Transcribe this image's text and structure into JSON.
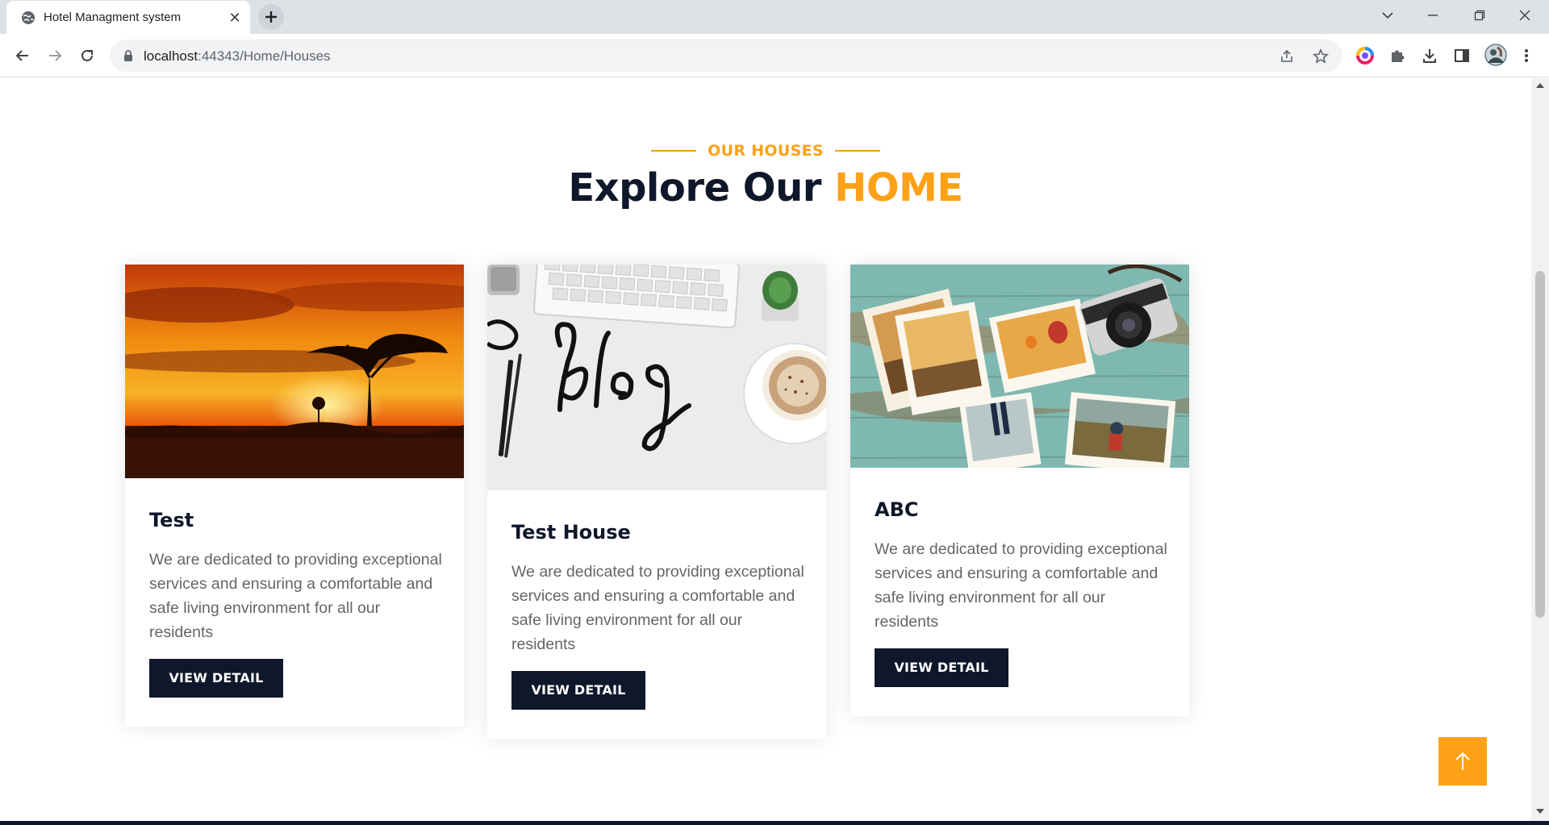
{
  "browser": {
    "tab_title": "Hotel Managment system",
    "tab_close": "✕",
    "url_host": "localhost",
    "url_rest": ":44343/Home/Houses",
    "icons": [
      "globe-icon",
      "close-icon",
      "plus-icon",
      "chevron-down-icon",
      "minimize-icon",
      "restore-icon",
      "close-window-icon",
      "back-arrow-icon",
      "forward-arrow-icon",
      "reload-icon",
      "lock-icon",
      "share-icon",
      "star-icon",
      "color-extension-icon",
      "puzzle-icon",
      "download-icon",
      "sidebar-icon",
      "avatar",
      "kebab-menu-icon"
    ]
  },
  "section": {
    "subtitle": "OUR HOUSES",
    "title_main": "Explore Our ",
    "title_accent": "HOME"
  },
  "houses": [
    {
      "name": "Test",
      "description": "We are dedicated to providing exceptional services and ensuring a comfortable and safe living environment for all our residents",
      "button": "VIEW DETAIL",
      "image": "savanna-sunset-image"
    },
    {
      "name": "Test House",
      "description": "We are dedicated to providing exceptional services and ensuring a comfortable and safe living environment for all our residents",
      "button": "VIEW DETAIL",
      "image": "blog-desk-image"
    },
    {
      "name": "ABC",
      "description": "We are dedicated to providing exceptional services and ensuring a comfortable and safe living environment for all our residents",
      "button": "VIEW DETAIL",
      "image": "travel-photos-image"
    }
  ],
  "back_to_top_icon": "arrow-up-icon",
  "colors": {
    "accent": "#fea116",
    "dark": "#0f172b",
    "body_text": "#666565"
  }
}
